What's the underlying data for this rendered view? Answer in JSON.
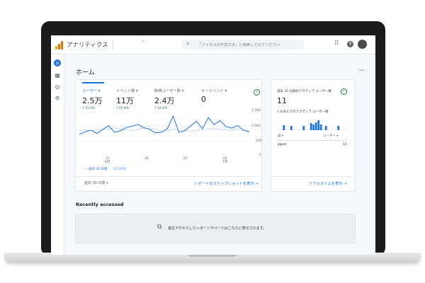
{
  "app": {
    "title": "アナリティクス",
    "breadcrumb_chevron": "›",
    "search_placeholder": "「ファネルの作成方法」と検索してみてください",
    "logo_colors": [
      "#f9ab00",
      "#e37400",
      "#e37400"
    ],
    "accent": "#1a73e8"
  },
  "icons": {
    "search": "⌕",
    "apps": "⠿",
    "help": "?",
    "home": "⌂",
    "reports": "▦",
    "explore": "◎",
    "advertising": "⊚",
    "insights": "〰",
    "recent": "⧉"
  },
  "home": {
    "title": "ホーム"
  },
  "overview": {
    "metrics": [
      {
        "label": "ユーザー ▾",
        "value": "2.5万",
        "change": "↑11.0%"
      },
      {
        "label": "イベント数 ▾",
        "value": "11万",
        "change": "↑25.9%"
      },
      {
        "label": "新規ユーザー数 ▾",
        "value": "2.4万",
        "change": "↑10.4%"
      },
      {
        "label": "キーイベント ▾",
        "value": "0",
        "change": "-"
      }
    ],
    "y_ticks": [
      "1,500",
      "1,000",
      "500",
      "0"
    ],
    "x_ticks": [
      {
        "day": "11",
        "month": "6月"
      },
      {
        "day": "18",
        "month": ""
      },
      {
        "day": "25",
        "month": ""
      },
      {
        "day": "02",
        "month": "7月"
      }
    ],
    "legend_current": "— 過去 30 日間",
    "legend_previous": "··· 前の期間",
    "date_range": "過去 30 日間 ▾",
    "snapshot_link": "レポートのスナップショットを表示 →"
  },
  "chart_data": {
    "type": "line",
    "x": [
      "6/6",
      "6/7",
      "6/8",
      "6/9",
      "6/10",
      "6/11",
      "6/12",
      "6/13",
      "6/14",
      "6/15",
      "6/16",
      "6/17",
      "6/18",
      "6/19",
      "6/20",
      "6/21",
      "6/22",
      "6/23",
      "6/24",
      "6/25",
      "6/26",
      "6/27",
      "6/28",
      "6/29",
      "6/30",
      "7/1",
      "7/2",
      "7/3",
      "7/4",
      "7/5"
    ],
    "series": [
      {
        "name": "過去 30 日間",
        "values": [
          720,
          820,
          870,
          760,
          900,
          1020,
          800,
          850,
          960,
          1010,
          1070,
          960,
          900,
          780,
          800,
          920,
          1350,
          790,
          860,
          1020,
          1180,
          920,
          1300,
          1060,
          1200,
          1000,
          940,
          1030,
          870,
          820
        ]
      },
      {
        "name": "前の期間",
        "values": [
          850,
          880,
          860,
          900,
          880,
          920,
          940,
          900,
          880,
          860,
          900,
          940,
          920,
          900,
          840,
          860,
          900,
          880,
          860,
          840,
          860,
          880,
          900,
          920,
          900,
          880,
          860,
          900,
          880,
          840
        ]
      }
    ],
    "ylim": [
      0,
      1500
    ],
    "colors": [
      "#1a73e8",
      "#7aaef0"
    ]
  },
  "realtime": {
    "label_active_users": "過去 30 分間のアクティブ ユーザー数",
    "value": "11",
    "per_minute_label": "1 分あたりのアクティブ ユーザー数",
    "per_minute_bars": [
      0,
      0,
      0.35,
      0,
      0,
      0.3,
      0,
      0,
      0,
      0,
      0.3,
      0,
      0,
      0.5,
      0.4,
      0.55,
      0.7,
      0.4,
      0,
      0.3,
      0,
      0,
      0,
      0,
      0.3,
      0,
      0,
      0
    ],
    "col_country": "国 ▾",
    "col_users": "ユーザー ▾",
    "rows": [
      {
        "country": "Japan",
        "users": "11"
      }
    ],
    "link": "リアルタイムを表示 →"
  },
  "recent": {
    "title": "Recently accessed",
    "empty_text": "最近アクセスしたレポートやページはこちらに表示されます。"
  }
}
